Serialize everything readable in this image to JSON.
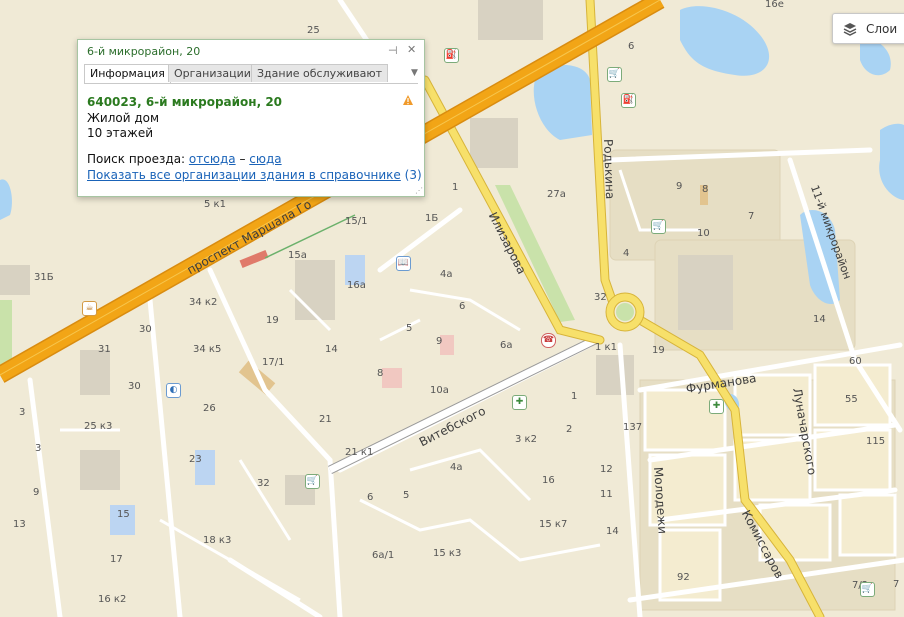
{
  "map": {
    "colors": {
      "background": "#f0ead6",
      "water": "#a9d3f3",
      "highway": "#f2a516",
      "road": "#ffffff",
      "main_road": "#f6d64a",
      "green": "#c4dfa4"
    },
    "streets": [
      {
        "name": "проспект Маршала Го",
        "id": "prospekt-marshala"
      },
      {
        "name": "Илизарова",
        "id": "ilizarova"
      },
      {
        "name": "Родькина",
        "id": "rodkina"
      },
      {
        "name": "11-й микрорайон",
        "id": "11-mikrorayon"
      },
      {
        "name": "Витебского",
        "id": "vitebskogo"
      },
      {
        "name": "Фурманова",
        "id": "furmanova"
      },
      {
        "name": "Луначарского",
        "id": "lunacharskogo"
      },
      {
        "name": "Молодежи",
        "id": "molodezhi"
      },
      {
        "name": "Комиссаров",
        "id": "komissarov"
      }
    ],
    "house_numbers": [
      "25",
      "6",
      "16е",
      "4",
      "27а",
      "9",
      "8",
      "7",
      "10",
      "1",
      "1Б",
      "15/1",
      "4а",
      "15а",
      "16а",
      "31Б",
      "34 к2",
      "30",
      "19",
      "5",
      "6",
      "14",
      "14",
      "32",
      "31",
      "34 к5",
      "17/1",
      "9",
      "6а",
      "19",
      "1 к1",
      "60",
      "30",
      "26",
      "8",
      "10а",
      "55",
      "3",
      "25 к3",
      "21",
      "1",
      "137",
      "3 к2",
      "2",
      "115",
      "3",
      "23",
      "21 к1",
      "4а",
      "12",
      "9",
      "32",
      "16",
      "15",
      "6",
      "5",
      "11",
      "13",
      "15 к7",
      "14",
      "18 к3",
      "17",
      "6а/1",
      "15 к3",
      "92",
      "16 к2",
      "7/2",
      "5 к1",
      "7"
    ]
  },
  "layers_button": {
    "label": "Слои",
    "icon": "layers-icon"
  },
  "popup": {
    "title": "6-й микрорайон, 20",
    "pin_icon": "pin-icon",
    "close_icon": "close-icon",
    "tabs": [
      {
        "label": "Информация",
        "active": true
      },
      {
        "label": "Организации",
        "active": false
      },
      {
        "label": "Здание обслуживают",
        "active": false
      }
    ],
    "address": "640023, 6-й микрорайон, 20",
    "building_type": "Жилой дом",
    "floors": "10 этажей",
    "route_label": "Поиск проезда:",
    "route_from": "отсюда",
    "route_dash": "–",
    "route_to": "сюда",
    "show_all_link": "Показать все организации здания в справочнике",
    "show_all_count": "(3)",
    "warning_icon": "warning-icon"
  }
}
